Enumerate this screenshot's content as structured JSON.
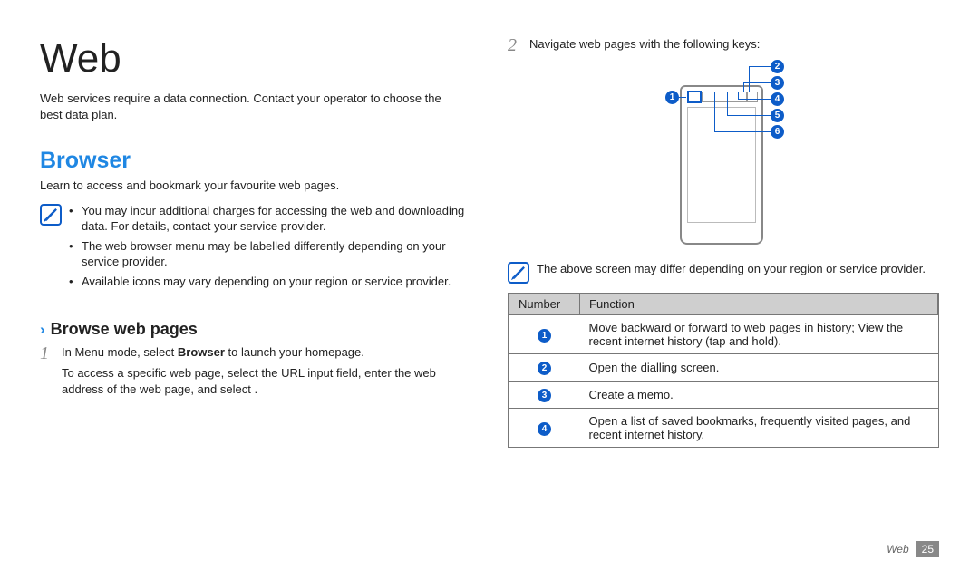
{
  "left": {
    "title": "Web",
    "intro": "Web services require a data connection. Contact your operator to choose the best data plan.",
    "section_heading": "Browser",
    "section_sub": "Learn to access and bookmark your favourite web pages.",
    "notes": [
      "You may incur additional charges for accessing the web and downloading data. For details, contact your service provider.",
      "The web browser menu may be labelled differently depending on your service provider.",
      "Available icons may vary depending on your region or service provider."
    ],
    "subhead": "Browse web pages",
    "step1_num": "1",
    "step1_line1_pre": "In Menu mode, select ",
    "step1_line1_bold": "Browser",
    "step1_line1_post": " to launch your homepage.",
    "step1_line2": "To access a specific web page, select the URL input field, enter the web address of the web page, and select      ."
  },
  "right": {
    "step2_num": "2",
    "step2_text": "Navigate web pages with the following keys:",
    "diagram_callouts": [
      "1",
      "2",
      "3",
      "4",
      "5",
      "6"
    ],
    "note": "The above screen may differ depending on your region or service provider.",
    "table": {
      "head_number": "Number",
      "head_function": "Function",
      "rows": [
        {
          "n": "1",
          "f": "Move backward or forward to web pages in history; View the recent internet history (tap and hold)."
        },
        {
          "n": "2",
          "f": "Open the dialling screen."
        },
        {
          "n": "3",
          "f": "Create a memo."
        },
        {
          "n": "4",
          "f": "Open a list of saved bookmarks, frequently visited pages, and recent internet history."
        }
      ]
    }
  },
  "footer": {
    "section": "Web",
    "page": "25"
  }
}
